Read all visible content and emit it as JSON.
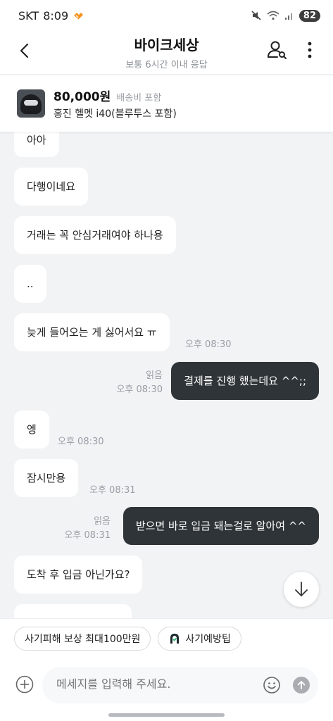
{
  "status": {
    "carrier": "SKT",
    "time": "8:09",
    "battery": "82"
  },
  "header": {
    "title": "바이크세상",
    "subtitle": "보통 6시간 이내 응답"
  },
  "product": {
    "price": "80,000원",
    "shipping": "배송비 포함",
    "name": "홍진 헬멧 i40(블루투스 포함)"
  },
  "messages": [
    {
      "dir": "in",
      "text": "아아"
    },
    {
      "dir": "in",
      "text": "다행이네요"
    },
    {
      "dir": "in",
      "text": "거래는 꼭 안심거래여야 하나용"
    },
    {
      "dir": "in",
      "text": ".."
    },
    {
      "dir": "in",
      "text": "늦게 들어오는 게 싫어서요 ㅠ",
      "time": "오후 08:30"
    },
    {
      "dir": "out",
      "text": "결제를  진행 했는데요 ^^;;",
      "read": "읽음",
      "time": "오후 08:30"
    },
    {
      "dir": "in",
      "text": "엥",
      "time": "오후 08:30"
    },
    {
      "dir": "in",
      "text": "잠시만용",
      "time": "오후 08:31"
    },
    {
      "dir": "out",
      "text": "받으면 바로 입금 돼는걸로  알아여 ^^",
      "read": "읽음",
      "time": "오후 08:31"
    },
    {
      "dir": "in",
      "text": "도착 후 입금 아닌가요?"
    }
  ],
  "chips": [
    "사기피해 보상 최대100만원",
    "사기예방팁"
  ],
  "composer": {
    "placeholder": "메세지를 입력해 주세요."
  },
  "colors": {
    "outgoing_bubble": "#2f3438",
    "incoming_bubble": "#ffffff",
    "background": "#f2f3f5",
    "accent": "#f7931e"
  }
}
